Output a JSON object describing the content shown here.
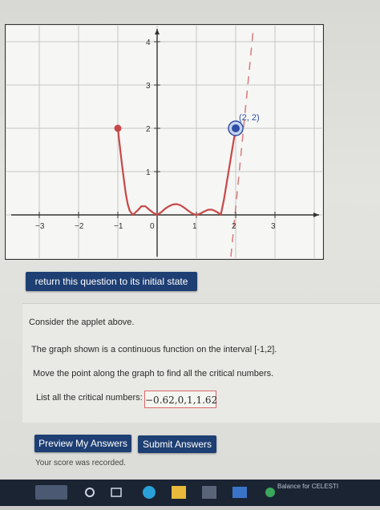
{
  "graph": {
    "x_tick_labels": [
      "−3",
      "−2",
      "−1",
      "0",
      "1",
      "2",
      "3"
    ],
    "y_tick_labels": [
      "1",
      "2",
      "3",
      "4"
    ],
    "point_label": "(2, 2)",
    "colors": {
      "curve": "#c84848",
      "point": "#2e4fa8",
      "grid": "#c5c5c5",
      "axis": "#333333",
      "dashed": "#d87a7a"
    }
  },
  "chart_data": {
    "type": "line",
    "x": [
      -1,
      -0.95,
      -0.9,
      -0.85,
      -0.8,
      -0.75,
      -0.7,
      -0.62,
      -0.5,
      -0.4,
      -0.3,
      -0.2,
      -0.1,
      0,
      0.1,
      0.2,
      0.3,
      0.4,
      0.5,
      0.6,
      0.7,
      0.8,
      0.9,
      1,
      1.1,
      1.2,
      1.3,
      1.4,
      1.5,
      1.6,
      1.62,
      1.7,
      1.8,
      1.9,
      2
    ],
    "y": [
      2,
      1.6,
      1.2,
      0.85,
      0.5,
      0.25,
      0.1,
      0.0,
      0.1,
      0.2,
      0.2,
      0.12,
      0.05,
      0,
      0.06,
      0.14,
      0.2,
      0.24,
      0.25,
      0.22,
      0.16,
      0.09,
      0.03,
      0,
      0.03,
      0.08,
      0.12,
      0.12,
      0.08,
      0.02,
      0.0,
      0.35,
      0.9,
      1.45,
      2
    ],
    "xlim": [
      -3.5,
      3.5
    ],
    "ylim": [
      -0.6,
      4.6
    ],
    "endpoints": [
      [
        -1,
        2
      ],
      [
        2,
        2
      ]
    ],
    "movable_point": [
      2,
      2
    ],
    "grid": true
  },
  "buttons": {
    "reset": "return this question to its initial state",
    "preview": "Preview My Answers",
    "submit": "Submit Answers"
  },
  "question": {
    "line1": "Consider the applet above.",
    "line2": "The graph shown is a continuous function on the interval [-1,2].",
    "line3": "Move the point along the graph to find all the critical numbers.",
    "line4": "List all the critical numbers:",
    "answer": "−0.62,0,1,1.62"
  },
  "score_text": "Your score was recorded.",
  "taskbar": {
    "balance_text": "Balance for CELESTI"
  }
}
